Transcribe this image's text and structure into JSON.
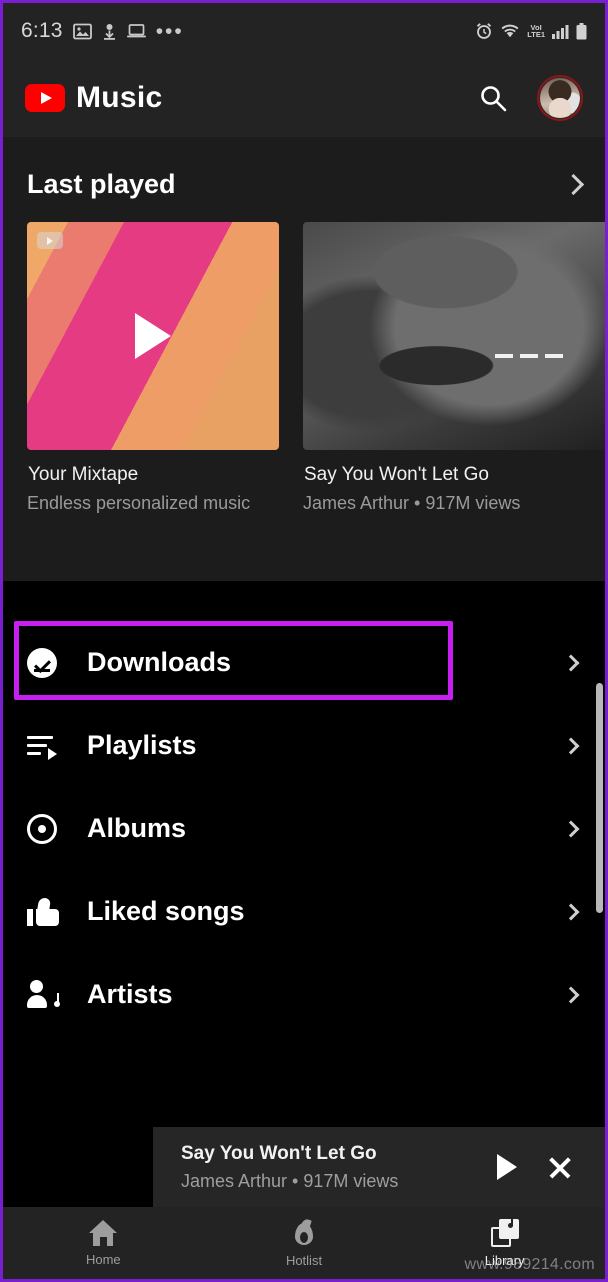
{
  "status_bar": {
    "time": "6:13",
    "left_icons": [
      "photo-icon",
      "download-icon",
      "laptop-icon"
    ],
    "overflow": "•••",
    "right_icons": [
      "alarm-icon",
      "wifi-icon",
      "signal-icon",
      "battery-icon"
    ],
    "volte_top": "VoI",
    "volte_bottom": "LTE1"
  },
  "header": {
    "app_title": "Music",
    "logo": "youtube-logo",
    "search_icon": "search-icon",
    "avatar": "account-avatar"
  },
  "last_played": {
    "section_title": "Last played",
    "chevron": "chevron-right-icon",
    "cards": [
      {
        "title": "Your Mixtape",
        "subtitle": "Endless personalized music",
        "thumb_type": "gradient-mixtape",
        "badge": "youtube-badge-icon",
        "overlay": "play-triangle"
      },
      {
        "title": "Say You Won't Let Go",
        "subtitle": "James Arthur • 917M views",
        "thumb_type": "photo-grayscale",
        "overlay": "three-dashes"
      }
    ]
  },
  "library_list": {
    "items": [
      {
        "label": "Downloads",
        "icon": "download-check-icon",
        "chevron": "chevron-right-icon",
        "highlighted": true
      },
      {
        "label": "Playlists",
        "icon": "playlist-icon",
        "chevron": "chevron-right-icon",
        "highlighted": false
      },
      {
        "label": "Albums",
        "icon": "album-disc-icon",
        "chevron": "chevron-right-icon",
        "highlighted": false
      },
      {
        "label": "Liked songs",
        "icon": "thumbs-up-icon",
        "chevron": "chevron-right-icon",
        "highlighted": false
      },
      {
        "label": "Artists",
        "icon": "artist-icon",
        "chevron": "chevron-right-icon",
        "highlighted": false
      }
    ]
  },
  "mini_player": {
    "title": "Say You Won't Let Go",
    "subtitle": "James Arthur • 917M views",
    "play_icon": "play-icon",
    "close_icon": "close-icon"
  },
  "bottom_nav": {
    "items": [
      {
        "label": "Home",
        "icon": "home-icon",
        "active": false
      },
      {
        "label": "Hotlist",
        "icon": "fire-icon",
        "active": false
      },
      {
        "label": "Library",
        "icon": "library-icon",
        "active": true
      }
    ]
  },
  "watermark": "www.989214.com",
  "colors": {
    "highlight": "#c61ff0",
    "frame": "#7a1fd0",
    "brand_red": "#ff0000",
    "surface": "#232323",
    "section_bg": "#1c1c1c",
    "background": "#000000"
  }
}
